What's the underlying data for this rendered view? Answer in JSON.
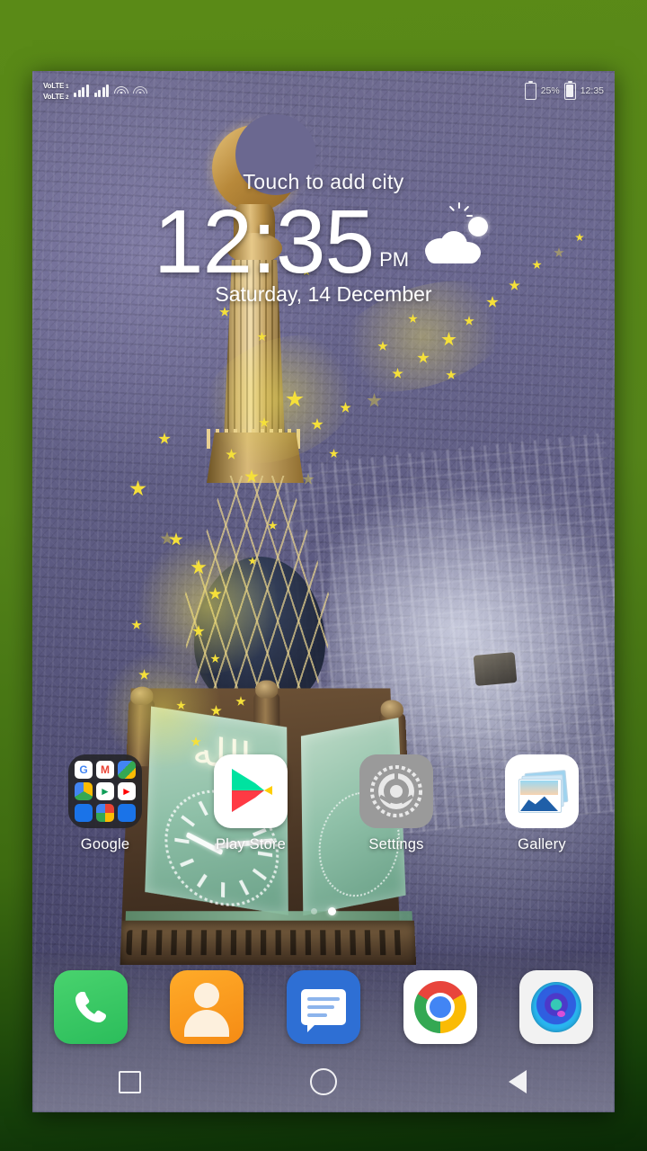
{
  "frame": {
    "border_color": "#55851a"
  },
  "statusbar": {
    "volte1": {
      "label": "VoLTE",
      "sim": "1"
    },
    "volte2": {
      "label": "VoLTE",
      "sim": "2"
    },
    "signal1_icon": "signal-bars-icon",
    "signal2_icon": "signal-bars-icon",
    "wifi_icon": "wifi-icon",
    "bluetooth_icon": "bluetooth-icon",
    "battery1_pct": "25%",
    "battery2_icon": "battery-icon",
    "clock": "12:35"
  },
  "widget": {
    "add_city": "Touch to add city",
    "time": "12:35",
    "ampm": "PM",
    "date": "Saturday, 14 December",
    "weather_icon": "partly-cloudy-icon"
  },
  "apps": [
    {
      "label": "Google",
      "icon": "google-folder-icon"
    },
    {
      "label": "Play Store",
      "icon": "play-store-icon"
    },
    {
      "label": "Settings",
      "icon": "settings-gear-icon"
    },
    {
      "label": "Gallery",
      "icon": "gallery-photos-icon"
    }
  ],
  "folder_apps": [
    {
      "name": "Google Search",
      "glyph": "G",
      "color": "#4285f4"
    },
    {
      "name": "Gmail",
      "glyph": "M",
      "color": "#ea4335"
    },
    {
      "name": "Maps",
      "glyph": "➤",
      "color": "#34a853"
    },
    {
      "name": "Drive",
      "glyph": "△",
      "color": "#fbbc04"
    },
    {
      "name": "Play Store",
      "glyph": "▶",
      "color": "#0f9d58"
    },
    {
      "name": "YouTube",
      "glyph": "▶",
      "color": "#ff0000"
    },
    {
      "name": "Duo",
      "glyph": "■",
      "color": "#1a73e8"
    },
    {
      "name": "Photos",
      "glyph": "✿",
      "color": "#ea4335"
    },
    {
      "name": "Keep",
      "glyph": "▬",
      "color": "#1a73e8"
    }
  ],
  "dock": [
    {
      "label": "Phone",
      "icon": "phone-icon",
      "color": "#34c85a"
    },
    {
      "label": "Contacts",
      "icon": "contacts-icon",
      "color": "#f79415"
    },
    {
      "label": "Messages",
      "icon": "messages-icon",
      "color": "#2e6fd4"
    },
    {
      "label": "Chrome",
      "icon": "chrome-icon",
      "color": "#ffffff"
    },
    {
      "label": "Camera",
      "icon": "camera-icon",
      "color": "#f2f2f2"
    }
  ],
  "page_indicator": {
    "pages": 2,
    "current": 2
  },
  "navbar": [
    {
      "label": "Recents",
      "icon": "square-recents-icon"
    },
    {
      "label": "Home",
      "icon": "circle-home-icon"
    },
    {
      "label": "Back",
      "icon": "triangle-back-icon"
    }
  ],
  "wallpaper": {
    "name": "mecca-clock-tower-live-wallpaper",
    "effect": "golden-stars-particles"
  }
}
